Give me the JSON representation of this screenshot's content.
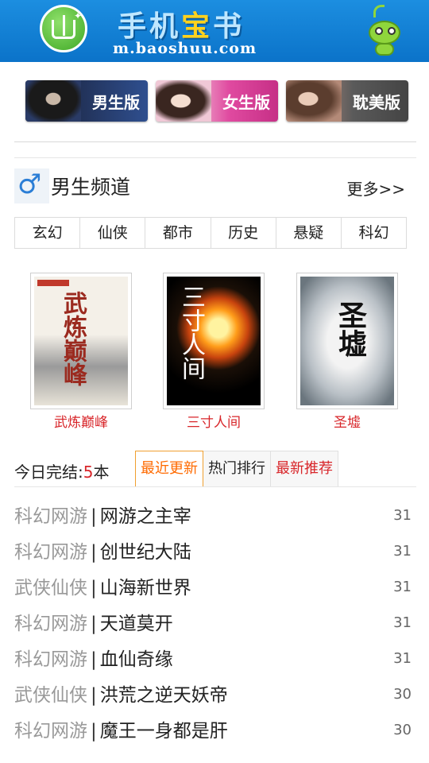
{
  "header": {
    "title_part1": "手机",
    "title_part2": "宝",
    "title_part3": "书",
    "url": "m.baoshuu.com"
  },
  "versions": [
    {
      "label": "男生版"
    },
    {
      "label": "女生版"
    },
    {
      "label": "耽美版"
    }
  ],
  "channel": {
    "icon_glyph": "♂",
    "title": "男生频道",
    "more": "更多>>"
  },
  "categories": [
    "玄幻",
    "仙侠",
    "都市",
    "历史",
    "悬疑",
    "科幻"
  ],
  "books": [
    {
      "title": "武炼巅峰",
      "cover_text": "武炼巅峰"
    },
    {
      "title": "三寸人间",
      "cover_text": "三寸人间"
    },
    {
      "title": "圣墟",
      "cover_text": "圣墟"
    }
  ],
  "completed": {
    "label": "今日完结:",
    "count": "5",
    "unit": "本"
  },
  "list_tabs": [
    "最近更新",
    "热门排行",
    "最新推荐"
  ],
  "list": [
    {
      "category": "科幻网游",
      "separator": "|",
      "title": "网游之主宰",
      "date": "31"
    },
    {
      "category": "科幻网游",
      "separator": "|",
      "title": "创世纪大陆",
      "date": "31"
    },
    {
      "category": "武侠仙侠",
      "separator": "|",
      "title": "山海新世界",
      "date": "31"
    },
    {
      "category": "科幻网游",
      "separator": "|",
      "title": "天道莫开",
      "date": "31"
    },
    {
      "category": "科幻网游",
      "separator": "|",
      "title": "血仙奇缘",
      "date": "31"
    },
    {
      "category": "武侠仙侠",
      "separator": "|",
      "title": "洪荒之逆天妖帝",
      "date": "30"
    },
    {
      "category": "科幻网游",
      "separator": "|",
      "title": "魔王一身都是肝",
      "date": "30"
    }
  ]
}
